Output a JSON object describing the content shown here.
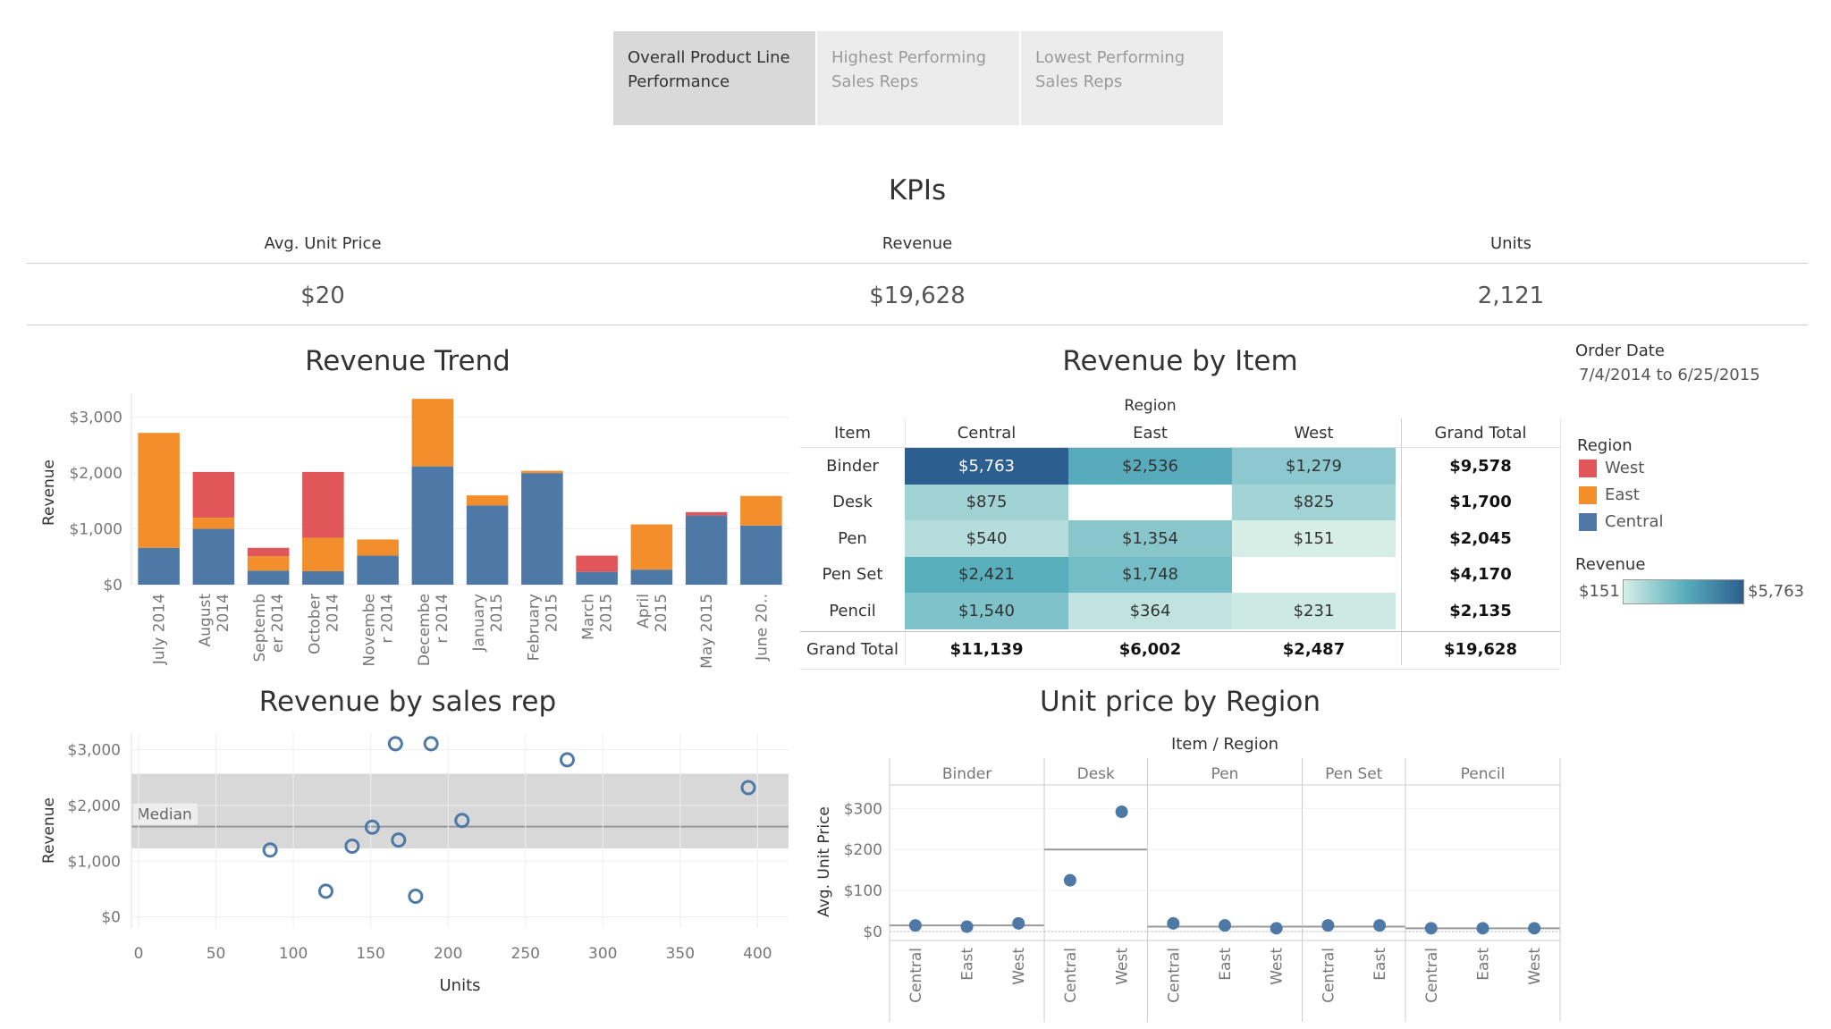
{
  "tabs": [
    {
      "label": "Overall Product Line Performance",
      "line1": "Overall Product Line",
      "line2": "Performance",
      "active": true
    },
    {
      "label": "Highest Performing Sales Reps",
      "line1": "Highest Performing",
      "line2": "Sales Reps",
      "active": false
    },
    {
      "label": "Lowest Performing Sales Reps",
      "line1": "Lowest Performing",
      "line2": "Sales Reps",
      "active": false
    }
  ],
  "kpis": {
    "title": "KPIs",
    "items": [
      {
        "label": "Avg. Unit Price",
        "value": "$20"
      },
      {
        "label": "Revenue",
        "value": "$19,628"
      },
      {
        "label": "Units",
        "value": "2,121"
      }
    ]
  },
  "filters": {
    "order_date_label": "Order Date",
    "order_date_value": "7/4/2014 to 6/25/2015"
  },
  "legend": {
    "region_title": "Region",
    "regions": [
      {
        "name": "West",
        "color": "#e15759"
      },
      {
        "name": "East",
        "color": "#f28e2b"
      },
      {
        "name": "Central",
        "color": "#4e79a7"
      }
    ],
    "revenue_title": "Revenue",
    "revenue_min": "$151",
    "revenue_max": "$5,763"
  },
  "colors": {
    "central": "#4e79a7",
    "east": "#f28e2b",
    "west": "#e15759"
  },
  "chart_data": [
    {
      "id": "revenue_trend",
      "type": "bar",
      "title": "Revenue Trend",
      "ylabel": "Revenue",
      "ylim": [
        0,
        3300
      ],
      "yticks": [
        0,
        1000,
        2000,
        3000
      ],
      "ytick_labels": [
        "$0",
        "$1,000",
        "$2,000",
        "$3,000"
      ],
      "stacked": true,
      "categories": [
        [
          "July 2014"
        ],
        [
          "August",
          "2014"
        ],
        [
          "Septemb",
          "er 2014"
        ],
        [
          "October",
          "2014"
        ],
        [
          "Novembe",
          "r 2014"
        ],
        [
          "Decembe",
          "r 2014"
        ],
        [
          "January",
          "2015"
        ],
        [
          "February",
          "2015"
        ],
        [
          "March",
          "2015"
        ],
        [
          "April",
          "2015"
        ],
        [
          "May 2015"
        ],
        [
          "June 20.."
        ]
      ],
      "series": [
        {
          "name": "Central",
          "values": [
            660,
            1000,
            250,
            240,
            520,
            2120,
            1420,
            2000,
            230,
            270,
            1240,
            1060
          ]
        },
        {
          "name": "East",
          "values": [
            2060,
            200,
            260,
            600,
            290,
            1210,
            180,
            40,
            0,
            810,
            0,
            530
          ]
        },
        {
          "name": "West",
          "values": [
            0,
            820,
            150,
            1180,
            0,
            0,
            0,
            0,
            290,
            0,
            60,
            0
          ]
        }
      ]
    },
    {
      "id": "revenue_by_item",
      "type": "heatmap",
      "title": "Revenue by Item",
      "column_group": "Region",
      "row_header": "Item",
      "columns": [
        "Central",
        "East",
        "West"
      ],
      "total_column": "Grand Total",
      "rows": [
        {
          "item": "Binder",
          "cells": [
            "$5,763",
            "$2,536",
            "$1,279"
          ],
          "values": [
            5763,
            2536,
            1279
          ],
          "total": "$9,578"
        },
        {
          "item": "Desk",
          "cells": [
            "$875",
            "",
            "$825"
          ],
          "values": [
            875,
            null,
            825
          ],
          "total": "$1,700"
        },
        {
          "item": "Pen",
          "cells": [
            "$540",
            "$1,354",
            "$151"
          ],
          "values": [
            540,
            1354,
            151
          ],
          "total": "$2,045"
        },
        {
          "item": "Pen Set",
          "cells": [
            "$2,421",
            "$1,748",
            ""
          ],
          "values": [
            2421,
            1748,
            null
          ],
          "total": "$4,170"
        },
        {
          "item": "Pencil",
          "cells": [
            "$1,540",
            "$364",
            "$231"
          ],
          "values": [
            1540,
            364,
            231
          ],
          "total": "$2,135"
        }
      ],
      "grand_total_label": "Grand Total",
      "grand_totals": [
        "$11,139",
        "$6,002",
        "$2,487"
      ],
      "grand_total_all": "$19,628"
    },
    {
      "id": "revenue_by_sales_rep",
      "type": "scatter",
      "title": "Revenue by sales rep",
      "xlabel": "Units",
      "ylabel": "Revenue",
      "xlim": [
        0,
        420
      ],
      "ylim": [
        -200,
        3300
      ],
      "xticks": [
        0,
        50,
        100,
        150,
        200,
        250,
        300,
        350,
        400
      ],
      "yticks": [
        0,
        1000,
        2000,
        3000
      ],
      "ytick_labels": [
        "$0",
        "$1,000",
        "$2,000",
        "$3,000"
      ],
      "median": 1620,
      "band": [
        1230,
        2570
      ],
      "median_label": "Median",
      "points": [
        {
          "x": 85,
          "y": 1200
        },
        {
          "x": 121,
          "y": 460
        },
        {
          "x": 138,
          "y": 1270
        },
        {
          "x": 151,
          "y": 1610
        },
        {
          "x": 166,
          "y": 3110
        },
        {
          "x": 168,
          "y": 1380
        },
        {
          "x": 179,
          "y": 370
        },
        {
          "x": 189,
          "y": 3110
        },
        {
          "x": 209,
          "y": 1730
        },
        {
          "x": 277,
          "y": 2820
        },
        {
          "x": 394,
          "y": 2320
        }
      ]
    },
    {
      "id": "unit_price_by_region",
      "type": "scatter",
      "title": "Unit price by Region",
      "header": "Item / Region",
      "ylabel": "Avg. Unit Price",
      "ylim": [
        0,
        340
      ],
      "yticks": [
        0,
        100,
        200,
        300
      ],
      "ytick_labels": [
        "$0",
        "$100",
        "$200",
        "$300"
      ],
      "panels": [
        {
          "item": "Binder",
          "regions": [
            "Central",
            "East",
            "West"
          ],
          "values": [
            15,
            12,
            20
          ],
          "avg": 15
        },
        {
          "item": "Desk",
          "regions": [
            "Central",
            "West"
          ],
          "values": [
            125,
            292
          ],
          "avg": 200
        },
        {
          "item": "Pen",
          "regions": [
            "Central",
            "East",
            "West"
          ],
          "values": [
            20,
            15,
            8
          ],
          "avg": 12
        },
        {
          "item": "Pen Set",
          "regions": [
            "Central",
            "East"
          ],
          "values": [
            15,
            15
          ],
          "avg": 12
        },
        {
          "item": "Pencil",
          "regions": [
            "Central",
            "East",
            "West"
          ],
          "values": [
            8,
            8,
            8
          ],
          "avg": 8
        }
      ]
    }
  ]
}
